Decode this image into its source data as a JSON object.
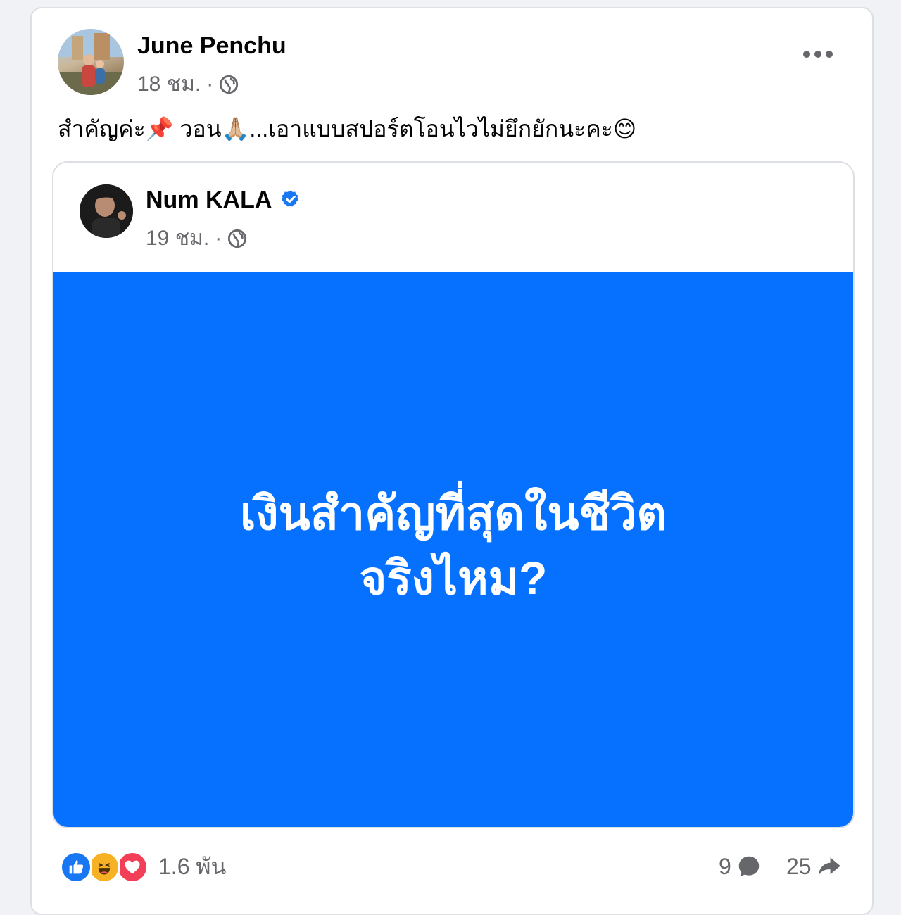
{
  "post": {
    "author": "June Penchu",
    "time": "18 ชม.",
    "separator": "·",
    "privacy_icon": "globe-icon",
    "more_icon": "more-options-icon",
    "text": "สำคัญค่ะ📌 วอน🙏🏼...เอาแบบสปอร์ตโอนไวไม่ยึกยักนะคะ😊"
  },
  "shared": {
    "author": "Num KALA",
    "verified_icon": "verified-badge-icon",
    "time": "19 ชม.",
    "separator": "·",
    "privacy_icon": "globe-icon",
    "background_color": "#0571fe",
    "headline_line1": "เงินสำคัญที่สุดในชีวิต",
    "headline_line2": "จริงไหม?"
  },
  "footer": {
    "reactions": [
      "like-icon",
      "haha-icon",
      "love-icon"
    ],
    "reaction_count": "1.6 พัน",
    "comment_count": "9",
    "share_count": "25"
  },
  "colors": {
    "accent": "#1877f2",
    "text": "#050505",
    "muted": "#65676b",
    "like": "#1877f2",
    "haha": "#f7b125",
    "love": "#f33e58"
  }
}
